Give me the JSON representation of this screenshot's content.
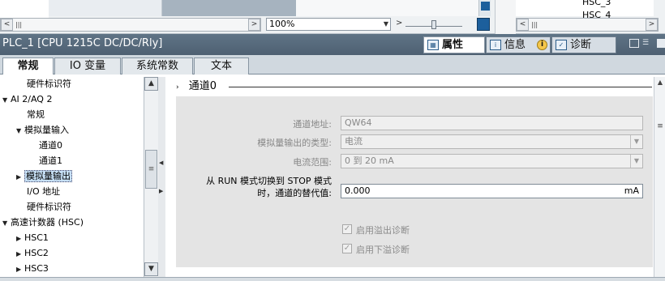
{
  "top_strip": {
    "zoom_value": "100%",
    "hsc_items": [
      "HSC_3",
      "HSC_4"
    ]
  },
  "title_bar": {
    "title": "PLC_1 [CPU 1215C DC/DC/Rly]",
    "tabs": [
      {
        "label": "属性",
        "icon": "properties-icon"
      },
      {
        "label": "信息",
        "icon": "info-icon"
      },
      {
        "label": "诊断",
        "icon": "diagnostics-icon"
      }
    ]
  },
  "tabs": [
    "常规",
    "IO 变量",
    "系统常数",
    "文本"
  ],
  "tree": [
    {
      "label": "硬件标识符",
      "level": 2,
      "tri": ""
    },
    {
      "label": "AI 2/AQ 2",
      "level": 0,
      "tri": "▼"
    },
    {
      "label": "常规",
      "level": 2,
      "tri": ""
    },
    {
      "label": "模拟量输入",
      "level": 1,
      "tri": "▼"
    },
    {
      "label": "通道0",
      "level": 3,
      "tri": ""
    },
    {
      "label": "通道1",
      "level": 3,
      "tri": ""
    },
    {
      "label": "模拟量输出",
      "level": 1,
      "tri": "▶",
      "selected": true
    },
    {
      "label": "I/O 地址",
      "level": 2,
      "tri": ""
    },
    {
      "label": "硬件标识符",
      "level": 2,
      "tri": ""
    },
    {
      "label": "高速计数器 (HSC)",
      "level": 0,
      "tri": "▼"
    },
    {
      "label": "HSC1",
      "level": 1,
      "tri": "▶"
    },
    {
      "label": "HSC2",
      "level": 1,
      "tri": "▶"
    },
    {
      "label": "HSC3",
      "level": 1,
      "tri": "▶"
    }
  ],
  "section": {
    "title": "通道0",
    "channel_address_label": "通道地址:",
    "channel_address_value": "QW64",
    "output_type_label": "模拟量输出的类型:",
    "output_type_value": "电流",
    "current_range_label": "电流范围:",
    "current_range_value": "0 到 20 mA",
    "substitute_label_line1": "从 RUN 模式切换到 STOP 模式",
    "substitute_label_line2": "时，通道的替代值:",
    "substitute_value": "0.000",
    "substitute_unit": "mA",
    "overflow_diag_label": "启用溢出诊断",
    "underflow_diag_label": "启用下溢诊断"
  }
}
